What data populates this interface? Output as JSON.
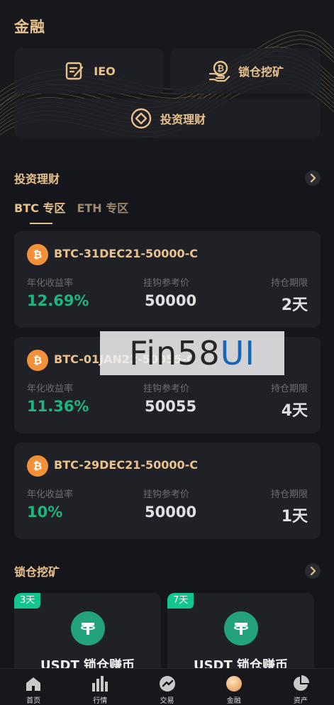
{
  "header": {
    "title": "金融"
  },
  "finance_tiles": [
    {
      "label": "IEO",
      "icon": "ieo-form-icon"
    },
    {
      "label": "锁仓挖矿",
      "icon": "bitcoin-hand-icon"
    },
    {
      "label": "投资理财",
      "icon": "target-coin-icon"
    }
  ],
  "invest": {
    "title": "投资理财",
    "tabs": [
      {
        "label": "BTC 专区",
        "active": true
      },
      {
        "label": "ETH 专区",
        "active": false
      }
    ],
    "cards": [
      {
        "name": "BTC-31DEC21-50000-C",
        "yield_label": "年化收益率",
        "yield": "12.69%",
        "price_label": "挂钩参考价",
        "price": "50000",
        "term_label": "持仓期限",
        "term": "2天"
      },
      {
        "name": "BTC-01JAN22-50055-C",
        "yield_label": "年化收益率",
        "yield": "11.36%",
        "price_label": "挂钩参考价",
        "price": "50055",
        "term_label": "持仓期限",
        "term": "4天"
      },
      {
        "name": "BTC-29DEC21-50000-C",
        "yield_label": "年化收益率",
        "yield": "10%",
        "price_label": "挂钩参考价",
        "price": "50000",
        "term_label": "持仓期限",
        "term": "1天"
      }
    ]
  },
  "watermark": {
    "part1": "Fin58",
    "part2": "UI"
  },
  "mining": {
    "title": "锁仓挖矿",
    "cards": [
      {
        "badge": "3天",
        "name": "USDT 锁仓赚币"
      },
      {
        "badge": "7天",
        "name": "USDT 锁仓赚币"
      }
    ]
  },
  "tabbar": [
    {
      "label": "首页",
      "icon": "home-icon",
      "active": false
    },
    {
      "label": "行情",
      "icon": "chart-bars-icon",
      "active": false
    },
    {
      "label": "交易",
      "icon": "trade-icon",
      "active": false
    },
    {
      "label": "金融",
      "icon": "finance-icon",
      "active": true
    },
    {
      "label": "资产",
      "icon": "pie-icon",
      "active": false
    }
  ],
  "colors": {
    "gold": "#e7c28e",
    "green": "#1fb57f",
    "badge": "#13c58f",
    "btc": "#f1923a",
    "usdt": "#23a37c",
    "bg": "#15161b",
    "card": "#202126"
  }
}
